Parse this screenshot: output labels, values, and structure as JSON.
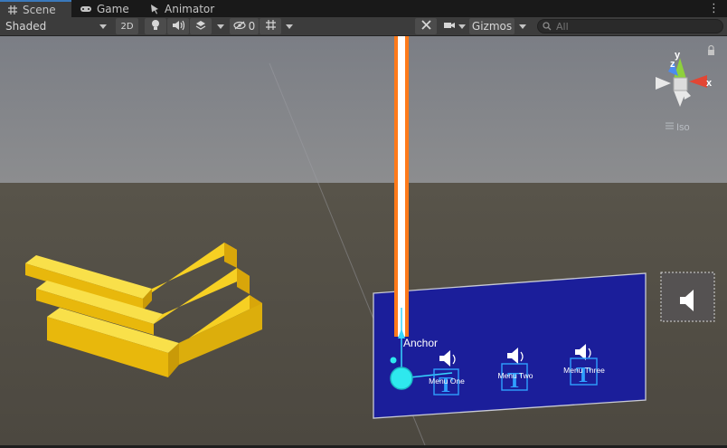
{
  "tabs": [
    {
      "label": "Scene",
      "icon": "grid-icon",
      "active": true
    },
    {
      "label": "Game",
      "icon": "gamepad-icon",
      "active": false
    },
    {
      "label": "Animator",
      "icon": "animator-icon",
      "active": false
    }
  ],
  "tab_menu": "⋮",
  "toolbar": {
    "draw_mode": "Shaded",
    "mode_2d": "2D",
    "hidden_count": "0",
    "gizmos_label": "Gizmos",
    "search_placeholder": "All"
  },
  "scene": {
    "anchor_label": "Anchor",
    "menu_items": [
      "Menu One",
      "Menu Two",
      "Menu Three"
    ],
    "text_glyph": "T",
    "iso_label": "Iso",
    "gizmo_axes": {
      "y": "y",
      "z": "z",
      "x": "x"
    }
  },
  "colors": {
    "sky": "#7e8187",
    "ground": "#545045",
    "canvas_panel": "#1b1e9a",
    "highlight": "#ff7a1a",
    "selection": "#2ee8ee",
    "blocks": "#f2c511"
  }
}
